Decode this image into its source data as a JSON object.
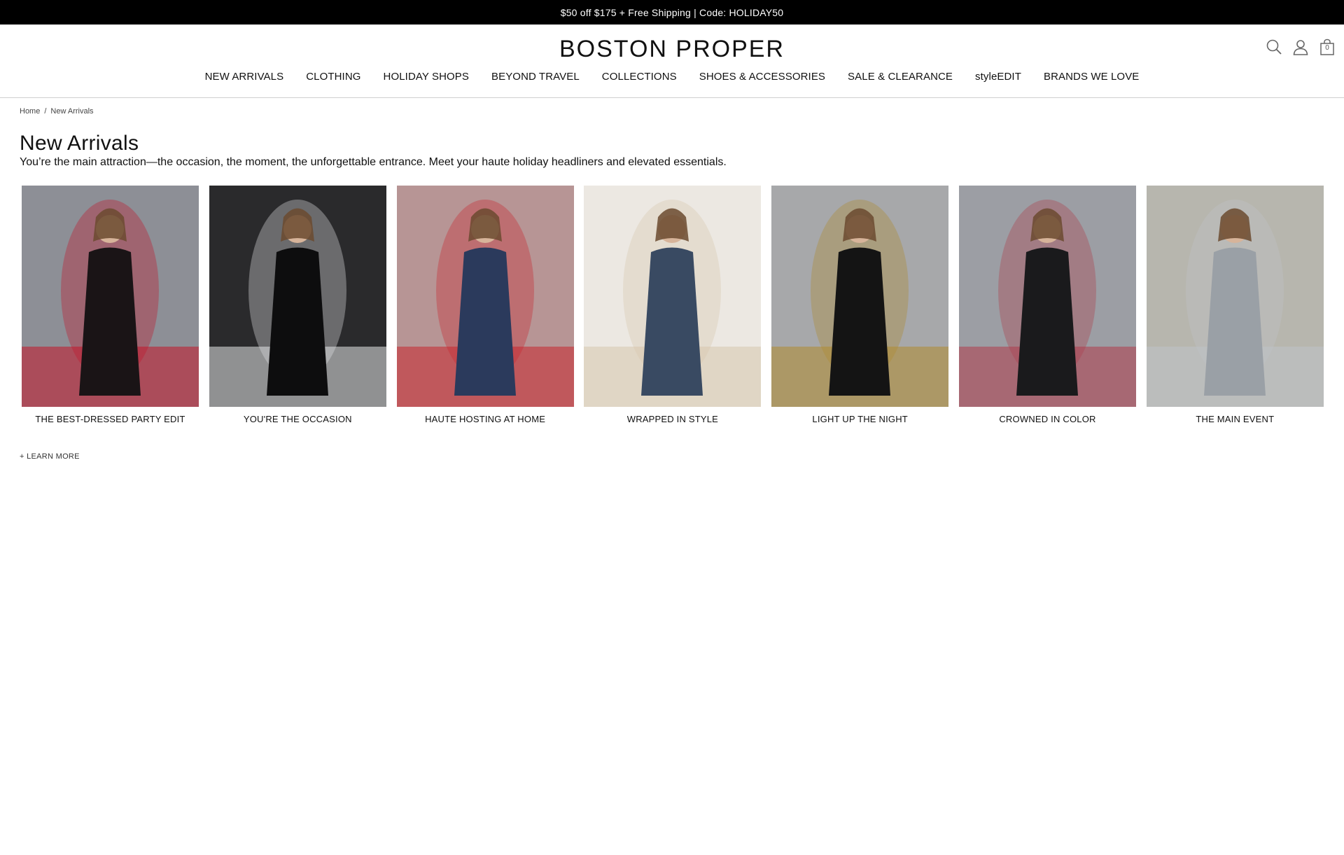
{
  "promo": {
    "text": "$50 off $175 + Free Shipping | Code: HOLIDAY50"
  },
  "header": {
    "logo": "BOSTON PROPER",
    "bag_count": "0",
    "icons": [
      "search-icon",
      "account-icon",
      "bag-icon"
    ]
  },
  "nav": {
    "items": [
      {
        "label": "NEW ARRIVALS"
      },
      {
        "label": "CLOTHING"
      },
      {
        "label": "HOLIDAY SHOPS"
      },
      {
        "label": "BEYOND TRAVEL"
      },
      {
        "label": "COLLECTIONS"
      },
      {
        "label": "SHOES & ACCESSORIES"
      },
      {
        "label": "SALE & CLEARANCE"
      },
      {
        "label": "styleEDIT"
      },
      {
        "label": "BRANDS WE LOVE"
      }
    ]
  },
  "breadcrumb": {
    "home": "Home",
    "separator": "/",
    "current": "New Arrivals"
  },
  "page": {
    "title": "New Arrivals",
    "description": "You’re the main attraction—the occasion, the moment, the unforgettable entrance. Meet your haute holiday headliners and elevated essentials."
  },
  "tiles": [
    {
      "label": "THE BEST-DRESSED PARTY EDIT",
      "bg": "#8d8f96",
      "accent": "#c4152a",
      "garment": "#1a1416"
    },
    {
      "label": "YOU'RE THE OCCASION",
      "bg": "#2a2a2c",
      "accent": "#e4e6e8",
      "garment": "#0d0d0e"
    },
    {
      "label": "HAUTE HOSTING AT HOME",
      "bg": "#b79595",
      "accent": "#c9262e",
      "garment": "#2b3a5c"
    },
    {
      "label": "WRAPPED IN STYLE",
      "bg": "#ece8e2",
      "accent": "#d7c7ad",
      "garment": "#394a62"
    },
    {
      "label": "LIGHT UP THE NIGHT",
      "bg": "#a7a8aa",
      "accent": "#b08a2e",
      "garment": "#141414"
    },
    {
      "label": "CROWNED IN COLOR",
      "bg": "#9c9ea4",
      "accent": "#b03c4a",
      "garment": "#1a1a1c"
    },
    {
      "label": "THE MAIN EVENT",
      "bg": "#b7b6ae",
      "accent": "#bfc3c8",
      "garment": "#9aa0a6"
    }
  ],
  "learn_more": "+ LEARN MORE"
}
